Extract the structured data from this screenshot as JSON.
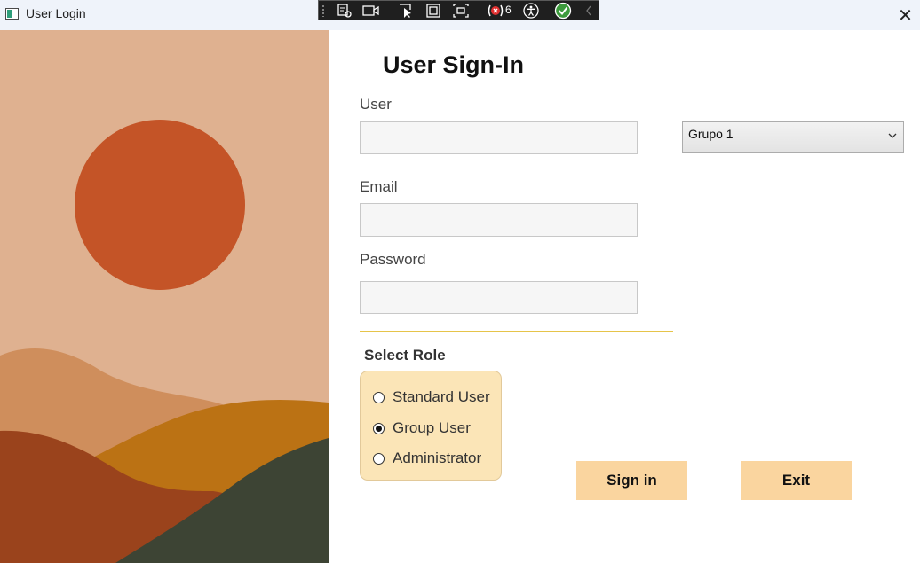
{
  "window": {
    "title": "User Login",
    "close_glyph": "✕"
  },
  "debug_toolbar": {
    "binding_error_count": "6",
    "icons": [
      "live-visual-tree-icon",
      "record-icon",
      "select-element-icon",
      "display-layout-adorners-icon",
      "track-focus-icon",
      "binding-failures-icon",
      "accessibility-icon",
      "ui-check-icon",
      "collapse-icon"
    ]
  },
  "form": {
    "title": "User Sign-In",
    "user": {
      "label": "User",
      "value": "",
      "placeholder": ""
    },
    "email": {
      "label": "Email",
      "value": "",
      "placeholder": ""
    },
    "password": {
      "label": "Password",
      "value": "",
      "placeholder": ""
    },
    "group": {
      "selected": "Grupo 1"
    }
  },
  "roles": {
    "label": "Select Role",
    "options": [
      {
        "label": "Standard User",
        "checked": false
      },
      {
        "label": "Group User",
        "checked": true
      },
      {
        "label": "Administrator",
        "checked": false
      }
    ]
  },
  "buttons": {
    "signin": "Sign in",
    "exit": "Exit"
  },
  "colors": {
    "art_sky": "#dfb190",
    "art_sun": "#c45427",
    "button": "#fad59f",
    "role_panel": "#fbe5b7",
    "separator": "#e6c44a"
  }
}
